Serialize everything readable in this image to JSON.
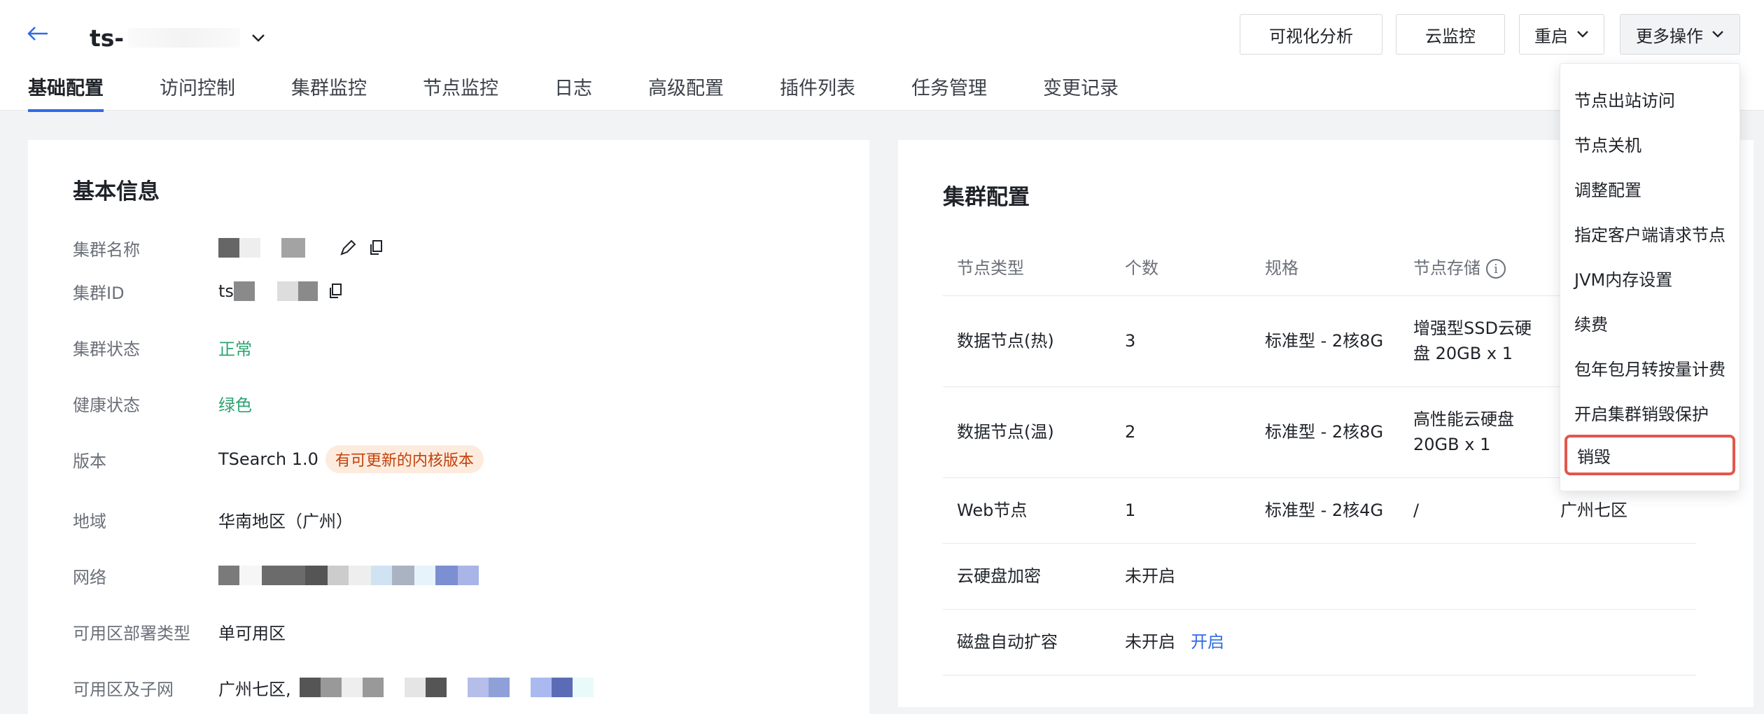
{
  "header": {
    "title_prefix": "ts-",
    "buttons": {
      "visual_analysis": "可视化分析",
      "cloud_monitor": "云监控",
      "restart": "重启",
      "more_actions": "更多操作"
    }
  },
  "tabs": [
    "基础配置",
    "访问控制",
    "集群监控",
    "节点监控",
    "日志",
    "高级配置",
    "插件列表",
    "任务管理",
    "变更记录"
  ],
  "basic_info": {
    "title": "基本信息",
    "cluster_name_label": "集群名称",
    "cluster_id_label": "集群ID",
    "cluster_id_prefix": "ts",
    "cluster_status_label": "集群状态",
    "cluster_status_value": "正常",
    "health_label": "健康状态",
    "health_value": "绿色",
    "version_label": "版本",
    "version_value": "TSearch 1.0",
    "version_badge": "有可更新的内核版本",
    "region_label": "地域",
    "region_value": "华南地区（广州）",
    "network_label": "网络",
    "az_type_label": "可用区部署类型",
    "az_type_value": "单可用区",
    "az_subnet_label": "可用区及子网",
    "az_subnet_value": "广州七区,"
  },
  "cluster_config": {
    "title": "集群配置",
    "columns": [
      "节点类型",
      "个数",
      "规格",
      "节点存储"
    ],
    "rows": [
      {
        "type": "数据节点(热)",
        "count": "3",
        "spec": "标准型 - 2核8G",
        "storage": "增强型SSD云硬盘 20GB x 1"
      },
      {
        "type": "数据节点(温)",
        "count": "2",
        "spec": "标准型 - 2核8G",
        "storage": "高性能云硬盘 20GB x 1"
      },
      {
        "type": "Web节点",
        "count": "1",
        "spec": "标准型 - 2核4G",
        "storage": "/",
        "zone": "广州七区"
      }
    ],
    "encrypt_label": "云硬盘加密",
    "encrypt_value": "未开启",
    "autoscale_label": "磁盘自动扩容",
    "autoscale_value": "未开启",
    "autoscale_link": "开启"
  },
  "dropdown": {
    "items": [
      "节点出站访问",
      "节点关机",
      "调整配置",
      "指定客户端请求节点",
      "JVM内存设置",
      "续费",
      "包年包月转按量计费",
      "开启集群销毁保护",
      "销毁"
    ]
  }
}
